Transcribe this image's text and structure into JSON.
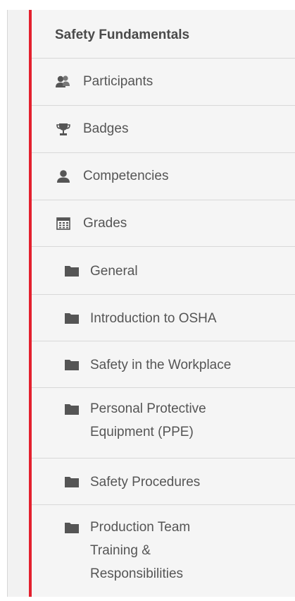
{
  "course": {
    "title": "Safety Fundamentals"
  },
  "menu": {
    "items": [
      {
        "label": "Participants",
        "icon": "participants-icon"
      },
      {
        "label": "Badges",
        "icon": "trophy-icon"
      },
      {
        "label": "Competencies",
        "icon": "user-icon"
      },
      {
        "label": "Grades",
        "icon": "gradebook-icon"
      }
    ]
  },
  "sections": {
    "items": [
      {
        "label": "General",
        "icon": "folder-icon"
      },
      {
        "label": "Introduction to OSHA",
        "icon": "folder-icon"
      },
      {
        "label": "Safety in the Workplace",
        "icon": "folder-icon"
      },
      {
        "label": "Personal Protective",
        "label2": "Equipment (PPE)",
        "icon": "folder-icon"
      },
      {
        "label": "Safety Procedures",
        "icon": "folder-icon"
      },
      {
        "label": "Production Team",
        "label2": "Training &",
        "label3": "Responsibilities",
        "icon": "folder-icon"
      }
    ]
  },
  "colors": {
    "accent": "#e3202e",
    "text": "#555555",
    "background": "#f5f5f5",
    "divider": "#d8d8d8"
  }
}
